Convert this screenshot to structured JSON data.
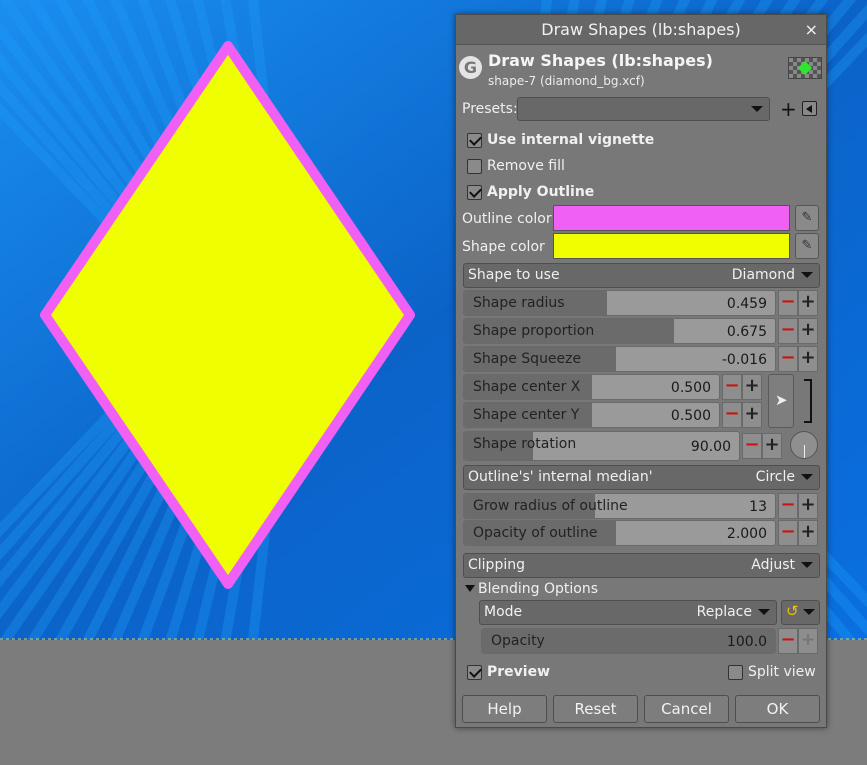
{
  "dialog": {
    "window_title": "Draw Shapes (lb:shapes)",
    "close_symbol": "×",
    "header_title": "Draw Shapes (lb:shapes)",
    "header_subtitle": "shape-7 (diamond_bg.xcf)",
    "logo_letter": "G"
  },
  "presets": {
    "label": "Presets:",
    "value": "",
    "add_symbol": "+"
  },
  "options": {
    "use_internal_vignette": {
      "label": "Use internal vignette",
      "checked": true
    },
    "remove_fill": {
      "label": "Remove fill",
      "checked": false
    },
    "apply_outline": {
      "label": "Apply Outline",
      "checked": true
    }
  },
  "colors": {
    "outline_label": "Outline color",
    "outline_value": "#f060f4",
    "shape_label": "Shape color",
    "shape_value": "#efff00"
  },
  "shape_to_use": {
    "label": "Shape to use",
    "value": "Diamond"
  },
  "sliders": {
    "shape_radius": {
      "label": "Shape radius",
      "value": "0.459",
      "fill": 0.459
    },
    "shape_proportion": {
      "label": "Shape proportion",
      "value": "0.675",
      "fill": 0.675
    },
    "shape_squeeze": {
      "label": "Shape Squeeze",
      "value": "-0.016",
      "fill": 0.49
    },
    "shape_center_x": {
      "label": "Shape center X",
      "value": "0.500",
      "fill": 0.5
    },
    "shape_center_y": {
      "label": "Shape center Y",
      "value": "0.500",
      "fill": 0.5
    },
    "shape_rotation": {
      "label": "Shape rotation",
      "value": "90.00",
      "fill": 0.25
    },
    "grow_radius": {
      "label": "Grow radius of outline",
      "value": "13",
      "fill": 0.42
    },
    "opacity_outline": {
      "label": "Opacity of outline",
      "value": "2.000",
      "fill": 0.49
    },
    "opacity": {
      "label": "Opacity",
      "value": "100.0",
      "fill": 1.0
    }
  },
  "outline_median": {
    "label": "Outline's' internal median'",
    "value": "Circle"
  },
  "clipping": {
    "label": "Clipping",
    "value": "Adjust"
  },
  "blending": {
    "label": "Blending Options",
    "mode_label": "Mode",
    "mode_value": "Replace"
  },
  "preview": {
    "label": "Preview",
    "checked": true
  },
  "split_view": {
    "label": "Split view",
    "checked": false
  },
  "buttons": {
    "help": "Help",
    "reset": "Reset",
    "cancel": "Cancel",
    "ok": "OK"
  },
  "canvas": {
    "background_color": "#0a72d8",
    "diamond_fill": "#efff00",
    "diamond_outline": "#f060f4"
  }
}
